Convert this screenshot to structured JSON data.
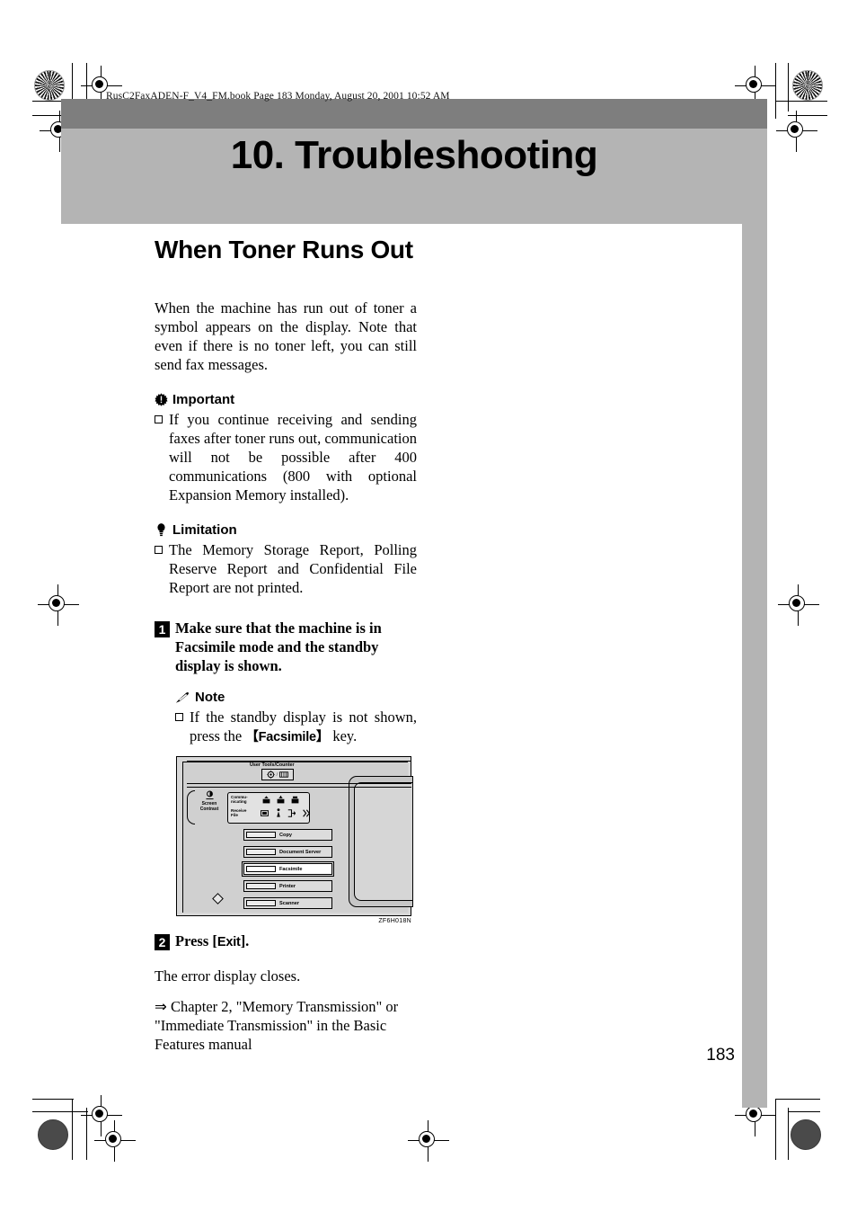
{
  "print_marks": {
    "book_header": "RusC2FaxADEN-F_V4_FM.book  Page 183  Monday, August 20, 2001  10:52 AM"
  },
  "chapter": {
    "number_and_title": "10. Troubleshooting"
  },
  "section": {
    "heading": "When Toner Runs Out",
    "intro": "When the machine has run out of toner a symbol appears on the display. Note that even if there is no toner left, you can still send fax messages."
  },
  "important": {
    "icon": "important-burst-icon",
    "label": "Important",
    "items": [
      "If you continue receiving and sending faxes after toner runs out, communication will not be possible after 400 communications (800 with optional Expansion Memory installed)."
    ]
  },
  "limitation": {
    "icon": "lightbulb-icon",
    "label": "Limitation",
    "items": [
      "The Memory Storage Report, Polling Reserve Report and Confidential File Report are not printed."
    ]
  },
  "steps": [
    {
      "number": "1",
      "text": "Make sure that the machine is in Facsimile mode and the standby display is shown."
    },
    {
      "number": "2",
      "text_before_key": "Press [",
      "key": "Exit",
      "text_after_key": "]."
    }
  ],
  "note": {
    "icon": "pencil-icon",
    "label": "Note",
    "item_prefix": "If the standby display is not shown, press the ",
    "item_key": "【Facsimile】",
    "item_suffix": " key."
  },
  "step2_body": {
    "result": "The error display closes.",
    "cross_reference": "⇒ Chapter 2, \"Memory Transmission\" or \"Immediate Transmission\" in the Basic Features manual"
  },
  "figure": {
    "caption": "ZF6H018N",
    "user_tools_label": "User Tools/Counter",
    "screen_contrast_label_line1": "Screen",
    "screen_contrast_label_line2": "Contrast",
    "status_labels": {
      "communicating_line1": "Commu-",
      "communicating_line2": "nicating",
      "receive_line1": "Receive",
      "receive_line2": "File"
    },
    "function_keys": [
      {
        "label": "Copy",
        "selected": false
      },
      {
        "label": "Document Server",
        "selected": false
      },
      {
        "label": "Facsimile",
        "selected": true
      },
      {
        "label": "Printer",
        "selected": false
      },
      {
        "label": "Scanner",
        "selected": false
      }
    ]
  },
  "footer": {
    "page_number": "183"
  },
  "colors": {
    "band_dark": "#7e7e7e",
    "band_light": "#b4b4b4",
    "text": "#000000",
    "page_bg": "#ffffff"
  }
}
